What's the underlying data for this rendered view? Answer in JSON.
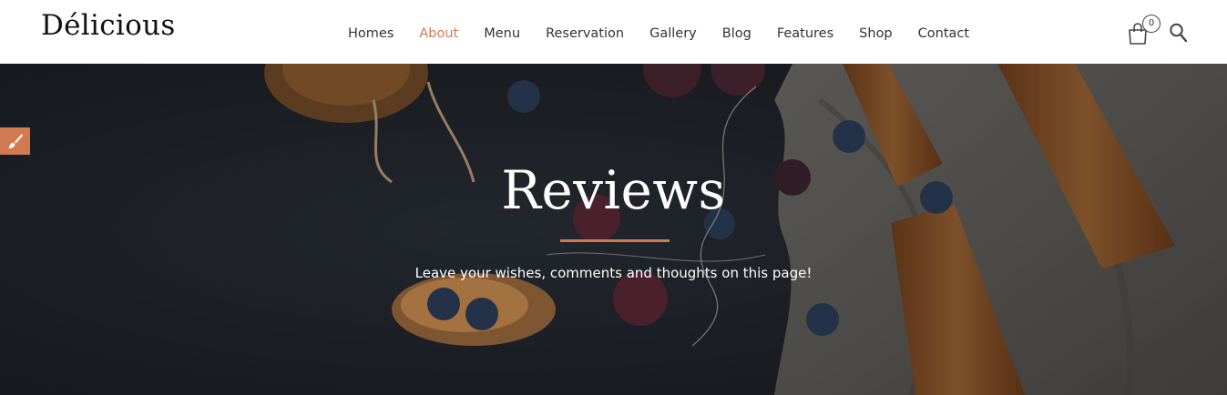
{
  "header": {
    "logo": "Délicious",
    "nav": [
      {
        "label": "Homes"
      },
      {
        "label": "About",
        "active": true
      },
      {
        "label": "Menu"
      },
      {
        "label": "Reservation"
      },
      {
        "label": "Gallery"
      },
      {
        "label": "Blog"
      },
      {
        "label": "Features"
      },
      {
        "label": "Shop"
      },
      {
        "label": "Contact"
      }
    ],
    "cart_count": "0",
    "icons": [
      "shopping-bag-icon",
      "search-icon"
    ]
  },
  "hero": {
    "title": "Reviews",
    "subtitle": "Leave your wishes, comments and thoughts on this page!"
  },
  "side_tool": {
    "icon": "paint-brush-icon"
  },
  "colors": {
    "accent": "#d17a52",
    "hero_background": "#20242c",
    "text_dark": "#333333"
  }
}
